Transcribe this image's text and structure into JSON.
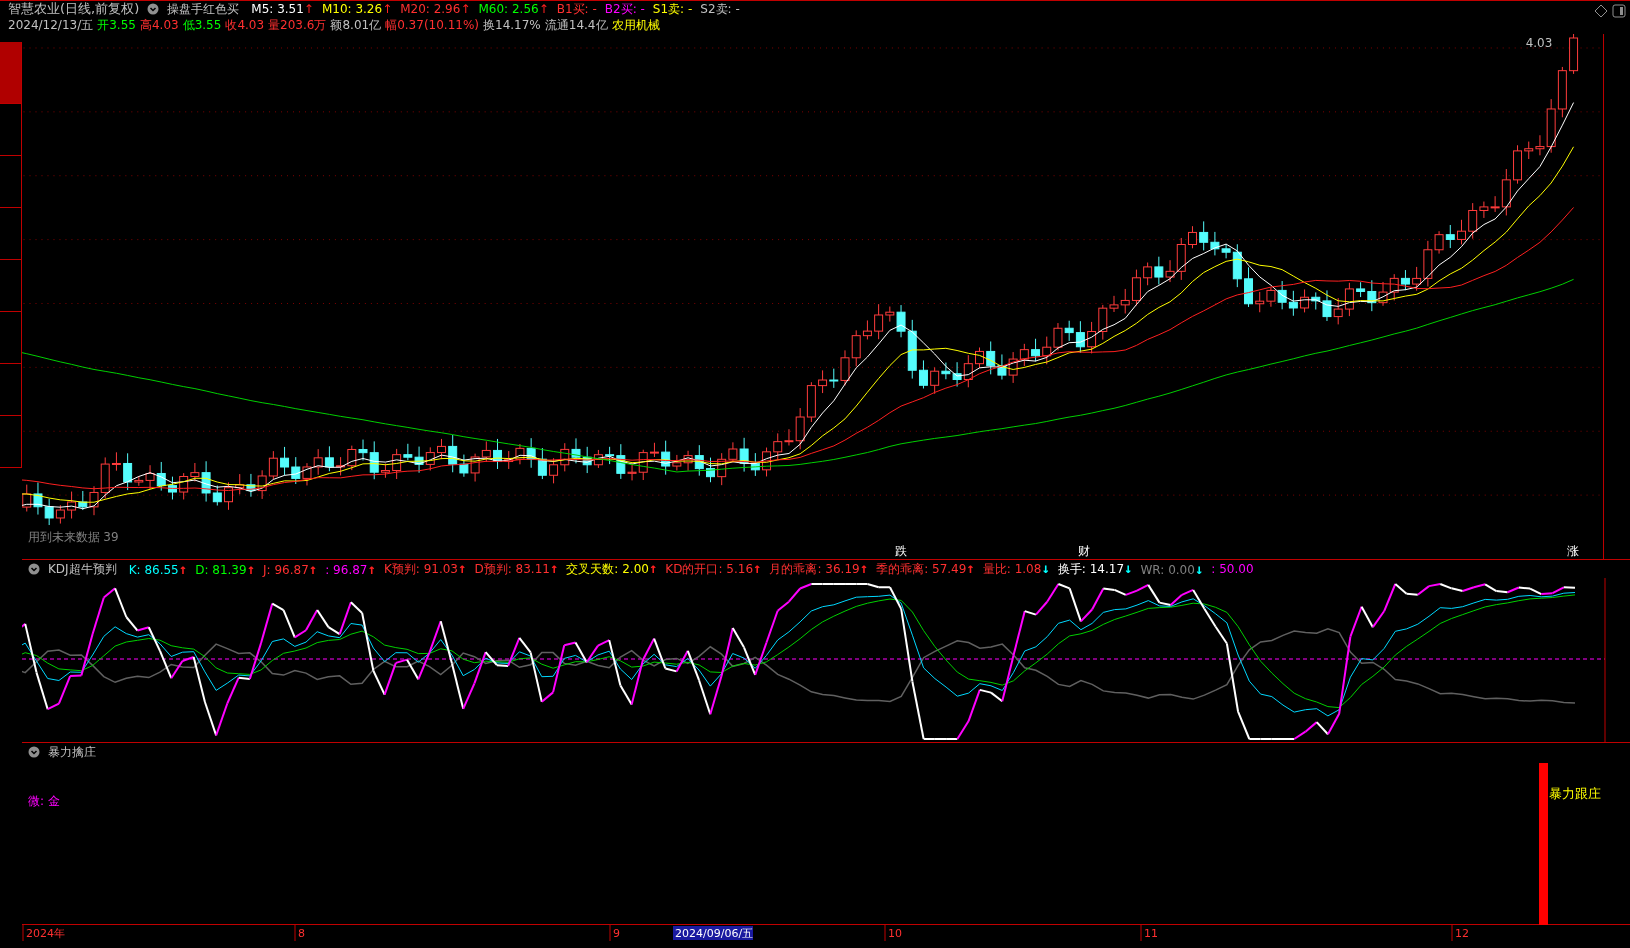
{
  "header": {
    "stock": "智慧农业(日线,前复权)",
    "indicator": "操盘手红色买",
    "ma": [
      {
        "text": "M5: 3.51",
        "arrow": "↑",
        "color": "#ffffff"
      },
      {
        "text": "M10: 3.26",
        "arrow": "↑",
        "color": "#ffff00"
      },
      {
        "text": "M20: 2.96",
        "arrow": "↑",
        "color": "#ff3030"
      },
      {
        "text": "M60: 2.56",
        "arrow": "↑",
        "color": "#00ff00"
      },
      {
        "text": "B1买: -",
        "color": "#ff3030"
      },
      {
        "text": "B2买: -",
        "color": "#ff00ff"
      },
      {
        "text": "S1卖: -",
        "color": "#ffff00"
      },
      {
        "text": "S2卖: -",
        "color": "#c0c0c0"
      }
    ],
    "quote": [
      {
        "text": "2024/12/13/五",
        "color": "#c0c0c0"
      },
      {
        "text": "开3.55",
        "color": "#00ff00"
      },
      {
        "text": "高4.03",
        "color": "#ff3030"
      },
      {
        "text": "低3.55",
        "color": "#00ff00"
      },
      {
        "text": "收4.03",
        "color": "#ff3030"
      },
      {
        "text": "量203.6万",
        "color": "#ff3030"
      },
      {
        "text": "额8.01亿",
        "color": "#c0c0c0"
      },
      {
        "text": "幅0.37(10.11%)",
        "color": "#ff3030"
      },
      {
        "text": "换14.17%",
        "color": "#c0c0c0"
      },
      {
        "text": "流通14.4亿",
        "color": "#c0c0c0"
      },
      {
        "text": "农用机械",
        "color": "#ffff00"
      }
    ]
  },
  "sidebar": {
    "tabs": [
      {
        "selected": true
      },
      {
        "selected": false
      },
      {
        "selected": false
      },
      {
        "selected": false
      },
      {
        "selected": false
      },
      {
        "selected": false
      },
      {
        "selected": false
      },
      {
        "selected": false
      }
    ]
  },
  "main_chart": {
    "price_label": "4.03",
    "note": "用到未来数据",
    "note_value": "39",
    "events": [
      "跌",
      "财",
      "涨"
    ]
  },
  "kdj": {
    "title": "KDJ超牛预判",
    "items": [
      {
        "text": "K: 86.55",
        "arrow": {
          "text": "↑",
          "color": "#ff2020"
        },
        "color": "#00ffff"
      },
      {
        "text": "D: 81.39",
        "arrow": {
          "text": "↑",
          "color": "#ff2020"
        },
        "color": "#00ff00"
      },
      {
        "text": "J: 96.87",
        "arrow": {
          "text": "↑",
          "color": "#ff2020"
        },
        "color": "#ff3030"
      },
      {
        "text": ": 96.87",
        "arrow": {
          "text": "↑",
          "color": "#ff2020"
        },
        "color": "#ff00ff"
      },
      {
        "text": "K预判: 91.03",
        "arrow": {
          "text": "↑",
          "color": "#ff2020"
        },
        "color": "#ff3030"
      },
      {
        "text": "D预判: 83.11",
        "arrow": {
          "text": "↑",
          "color": "#ff2020"
        },
        "color": "#ff3030"
      },
      {
        "text": "交叉天数: 2.00",
        "arrow": {
          "text": "↑",
          "color": "#ff2020"
        },
        "color": "#ffff00"
      },
      {
        "text": "KD的开口: 5.16",
        "arrow": {
          "text": "↑",
          "color": "#ff2020"
        },
        "color": "#ff3030"
      },
      {
        "text": "月的乖离: 36.19",
        "arrow": {
          "text": "↑",
          "color": "#ff2020"
        },
        "color": "#ff3030"
      },
      {
        "text": "季的乖离: 57.49",
        "arrow": {
          "text": "↑",
          "color": "#ff2020"
        },
        "color": "#ff3030"
      },
      {
        "text": "量比: 1.08",
        "arrow": {
          "text": "↓",
          "color": "#00ffff"
        },
        "color": "#ff3030"
      },
      {
        "text": "换手: 14.17",
        "arrow": {
          "text": "↓",
          "color": "#00ffff"
        },
        "color": "#ffffff"
      },
      {
        "text": "WR: 0.00",
        "arrow": {
          "text": "↓",
          "color": "#00ffff"
        },
        "color": "#808080"
      },
      {
        "text": ": 50.00",
        "color": "#ff00ff"
      }
    ]
  },
  "signal_panel": {
    "title": "暴力擒庄",
    "legend": "微: 金",
    "bar_label": "暴力跟庄"
  },
  "time_axis": [
    {
      "text": "2024年",
      "kind": "tick"
    },
    {
      "text": "8",
      "kind": "tick"
    },
    {
      "text": "9",
      "kind": "tick"
    },
    {
      "text": "2024/09/06/五",
      "kind": "cursor"
    },
    {
      "text": "10",
      "kind": "tick"
    },
    {
      "text": "11",
      "kind": "tick"
    },
    {
      "text": "12",
      "kind": "tick"
    }
  ]
}
